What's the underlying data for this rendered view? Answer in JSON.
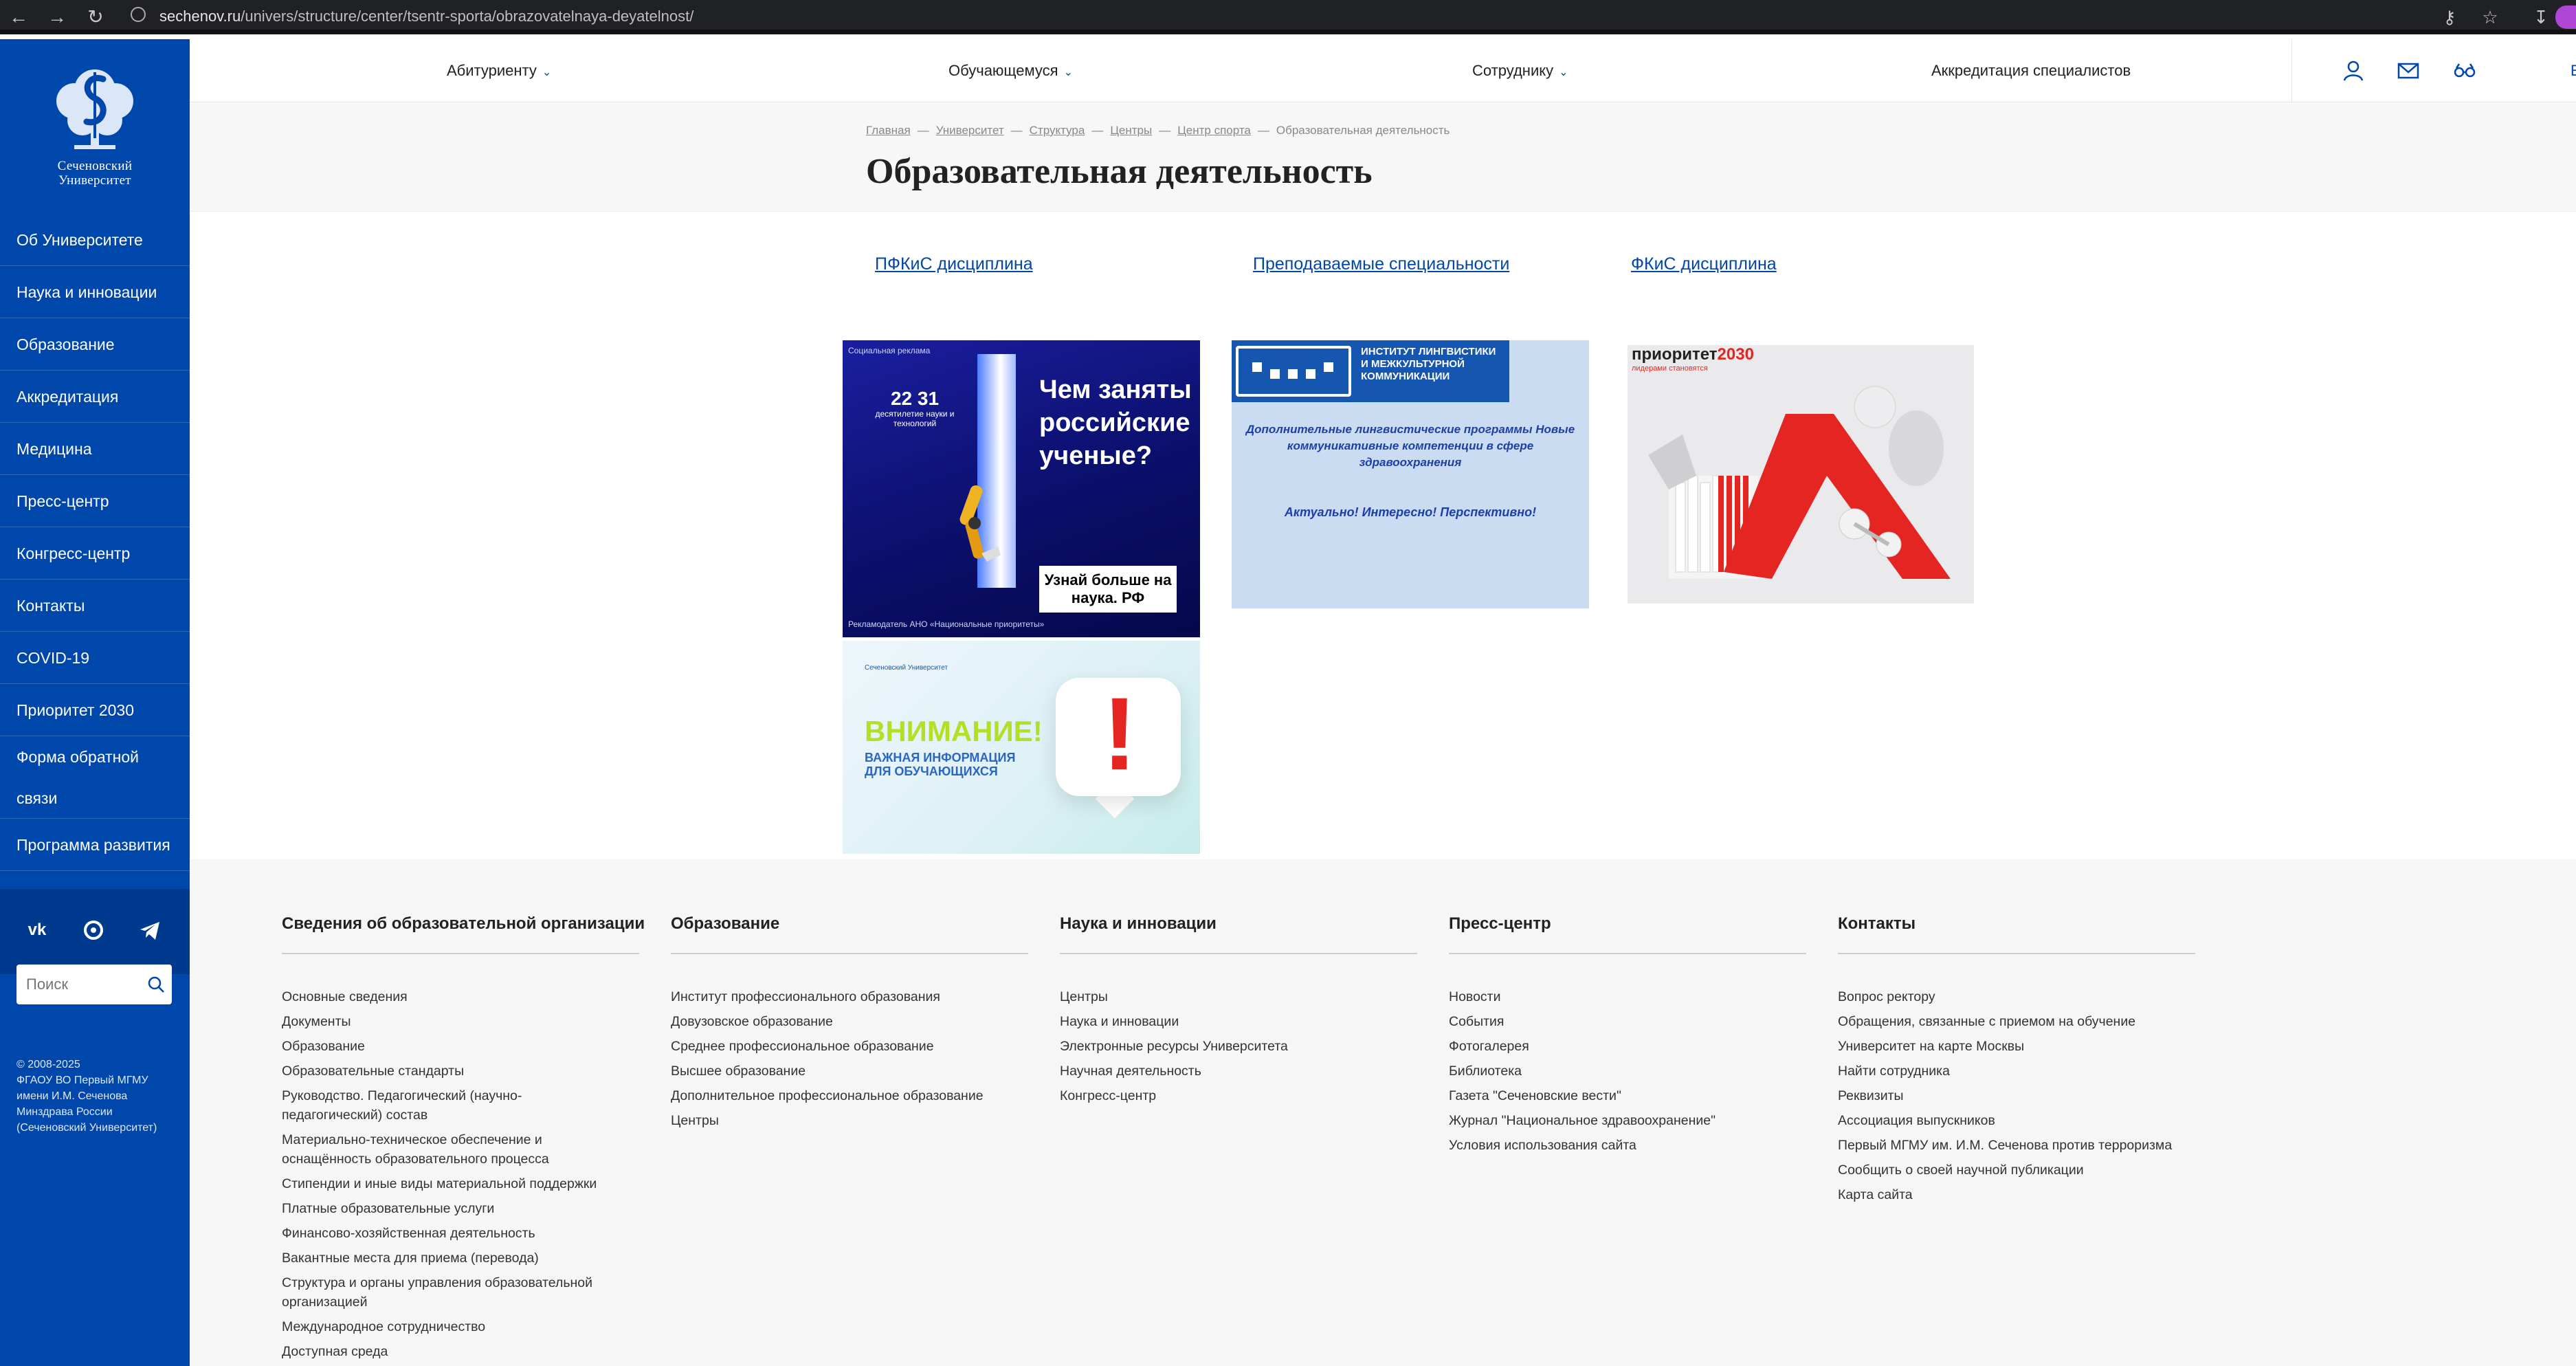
{
  "browser": {
    "url_host": "sechenov.ru",
    "url_path": "/univers/structure/center/tsentr-sporta/obrazovatelnaya-deyatelnost/"
  },
  "sidebar": {
    "logo_text_line1": "Сеченовский",
    "logo_text_line2": "Университет",
    "items": [
      {
        "label": "Об Университете"
      },
      {
        "label": "Наука и инновации"
      },
      {
        "label": "Образование"
      },
      {
        "label": "Аккредитация"
      },
      {
        "label": "Медицина"
      },
      {
        "label": "Пресс-центр"
      },
      {
        "label": "Конгресс-центр"
      },
      {
        "label": "Контакты"
      },
      {
        "label": "COVID-19"
      },
      {
        "label": "Приоритет 2030"
      },
      {
        "label": "Форма обратной связи"
      },
      {
        "label": "Программа развития"
      }
    ],
    "social": [
      "vk-icon",
      "ok-icon",
      "telegram-icon"
    ],
    "search_placeholder": "Поиск",
    "copyright_line1": "© 2008-2025",
    "copyright_line2": "ФГАОУ ВО Первый МГМУ",
    "copyright_line3": "имени И.М. Сеченова",
    "copyright_line4": "Минздрава России",
    "copyright_line5": "(Сеченовский Университет)"
  },
  "topnav": {
    "applicant": "Абитуриенту",
    "student": "Обучающемуся",
    "employee": "Сотруднику",
    "accreditation": "Аккредитация специалистов",
    "lang": "E",
    "icons": [
      "user-icon",
      "mail-icon",
      "glasses-icon"
    ]
  },
  "breadcrumb": {
    "items": [
      "Главная",
      "Университет",
      "Структура",
      "Центры",
      "Центр спорта"
    ],
    "current": "Образовательная деятельность",
    "sep": "—"
  },
  "page": {
    "title": "Образовательная деятельность",
    "links": [
      "ПФКиС дисциплина",
      "Преподаваемые специальности",
      "ФКиС дисциплина"
    ]
  },
  "banners": {
    "science": {
      "top_note": "Социальная реклама",
      "decade_num": "22 31",
      "decade_text": "десятилетие науки и технологий",
      "headline": "Чем заняты российские ученые?",
      "button": "Узнай больше на наука. РФ",
      "footer_note": "Рекламодатель АНО «Национальные приоритеты»"
    },
    "linguistics": {
      "header": "Институт лингвистики и межкультурной коммуникации",
      "body": "Дополнительные лингвистические программы Новые коммуникативные компетенции в сфере здравоохранения",
      "slogan": "Актуально! Интересно! Перспективно!"
    },
    "priority": {
      "brand_a": "приоритет",
      "brand_b": "2030",
      "tag": "лидерами становятся"
    },
    "attention": {
      "logo": "Сеченовский Университет",
      "headline": "ВНИМАНИЕ!",
      "sub": "ВАЖНАЯ ИНФОРМАЦИЯ ДЛЯ ОБУЧАЮЩИХСЯ",
      "mark": "!"
    }
  },
  "footer": {
    "columns": [
      {
        "title": "Сведения об образовательной организации",
        "items": [
          "Основные сведения",
          "Документы",
          "Образование",
          "Образовательные стандарты",
          "Руководство. Педагогический (научно-педагогический) состав",
          "Материально-техническое обеспечение и оснащённость образовательного процесса",
          "Стипендии и иные виды материальной поддержки",
          "Платные образовательные услуги",
          "Финансово-хозяйственная деятельность",
          "Вакантные места для приема (перевода)",
          "Структура и органы управления образовательной организацией",
          "Международное сотрудничество",
          "Доступная среда"
        ]
      },
      {
        "title": "Образование",
        "items": [
          "Институт профессионального образования",
          "Довузовское образование",
          "Среднее профессиональное образование",
          "Высшее образование",
          "Дополнительное профессиональное образование",
          "Центры"
        ]
      },
      {
        "title": "Наука и инновации",
        "items": [
          "Центры",
          "Наука и инновации",
          "Электронные ресурсы Университета",
          "Научная деятельность",
          "Конгресс-центр"
        ]
      },
      {
        "title": "Пресс-центр",
        "items": [
          "Новости",
          "События",
          "Фотогалерея",
          "Библиотека",
          "Газета \"Сеченовские вести\"",
          "Журнал \"Национальное здравоохранение\"",
          "Условия использования сайта"
        ]
      },
      {
        "title": "Контакты",
        "items": [
          "Вопрос ректору",
          "Обращения, связанные с приемом на обучение",
          "Университет на карте Москвы",
          "Найти сотрудника",
          "Реквизиты",
          "Ассоциация выпускников",
          "Первый МГМУ им. И.М. Сеченова против терроризма",
          "Сообщить о своей научной публикации",
          "Карта сайта"
        ]
      }
    ]
  },
  "colors": {
    "sidebar_blue": "#0047ab",
    "link_blue": "#0047ab",
    "accent_red": "#e52521"
  }
}
